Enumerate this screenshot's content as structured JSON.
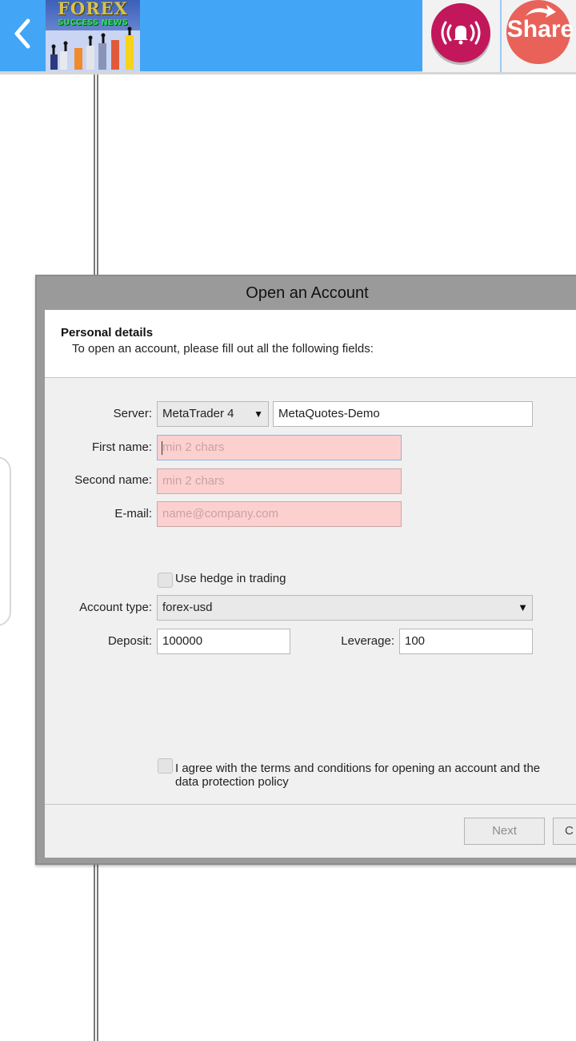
{
  "app_bar": {
    "logo_title": "FOREX",
    "logo_subtitle": "SUCCESS NEWS",
    "share_label": "Share",
    "back_icon": "chevron-left-icon",
    "broadcast_icon": "broadcast-bell-icon",
    "colors": {
      "bar": "#42a5f5",
      "bell_button": "#c2185b",
      "share_button": "#e8625a"
    }
  },
  "dialog": {
    "title": "Open an Account",
    "section_title": "Personal details",
    "section_subtitle": "To open an account, please fill out all the following fields:",
    "server": {
      "label": "Server:",
      "platform_value": "MetaTrader 4",
      "server_value": "MetaQuotes-Demo"
    },
    "first_name": {
      "label": "First name:",
      "placeholder": "min 2 chars"
    },
    "second_name": {
      "label": "Second name:",
      "placeholder": "min 2 chars"
    },
    "email": {
      "label": "E-mail:",
      "placeholder": "name@company.com"
    },
    "hedge": {
      "label": "Use hedge in trading",
      "checked": false
    },
    "account_type": {
      "label": "Account type:",
      "value": "forex-usd"
    },
    "deposit": {
      "label": "Deposit:",
      "value": "100000"
    },
    "leverage": {
      "label": "Leverage:",
      "value": "100"
    },
    "agree": {
      "label": "I agree with the terms and conditions for opening an account and the data protection policy",
      "checked": false
    },
    "buttons": {
      "next": "Next",
      "cancel": "C"
    },
    "colors": {
      "invalid_field": "#fdd0d0"
    }
  }
}
